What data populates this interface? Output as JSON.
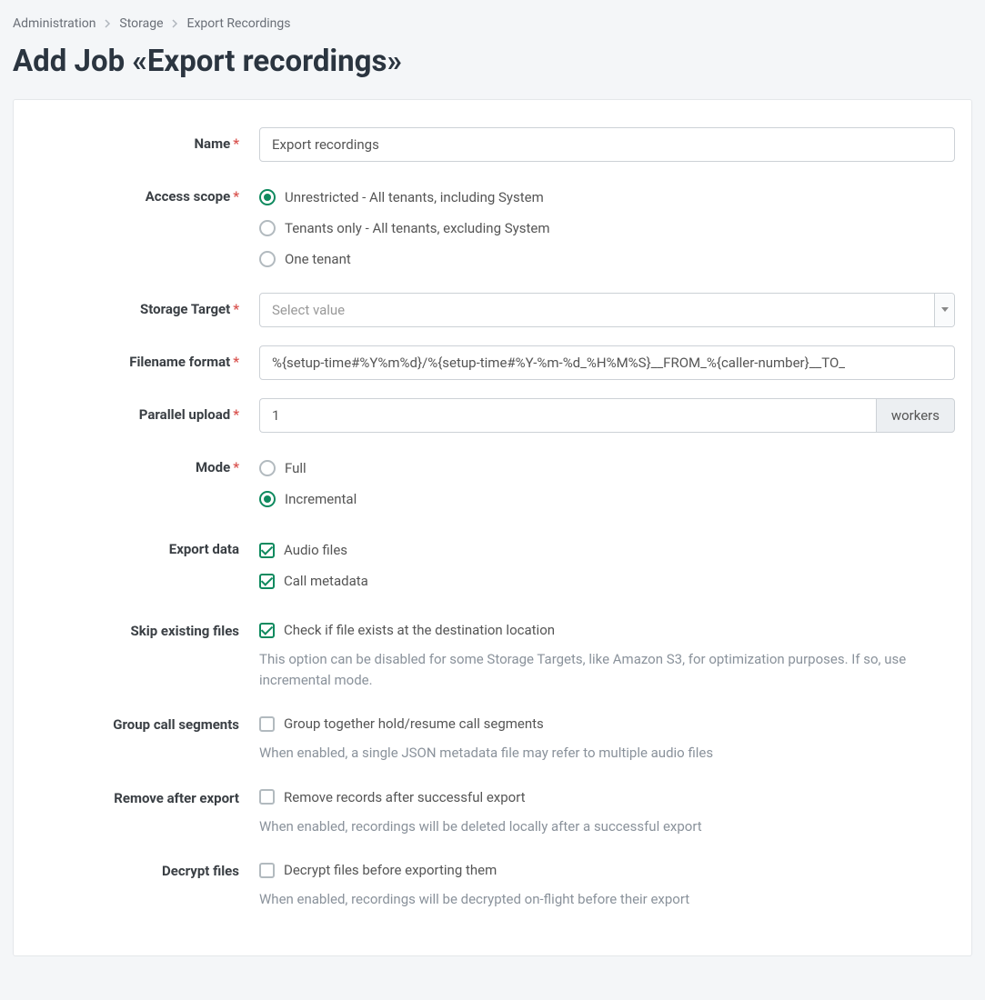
{
  "breadcrumb": {
    "items": [
      "Administration",
      "Storage",
      "Export Recordings"
    ]
  },
  "page_title": "Add Job «Export recordings»",
  "labels": {
    "name": "Name",
    "access_scope": "Access scope",
    "storage_target": "Storage Target",
    "filename_format": "Filename format",
    "parallel_upload": "Parallel upload",
    "mode": "Mode",
    "export_data": "Export data",
    "skip_existing": "Skip existing files",
    "group_segments": "Group call segments",
    "remove_after": "Remove after export",
    "decrypt_files": "Decrypt files"
  },
  "form": {
    "name_value": "Export recordings",
    "access_scope_options": {
      "unrestricted": "Unrestricted - All tenants, including System",
      "tenants_only": "Tenants only - All tenants, excluding System",
      "one_tenant": "One tenant"
    },
    "storage_target_placeholder": "Select value",
    "filename_format_value": "%{setup-time#%Y%m%d}/%{setup-time#%Y-%m-%d_%H%M%S}__FROM_%{caller-number}__TO_",
    "parallel_upload_value": "1",
    "parallel_upload_unit": "workers",
    "mode_options": {
      "full": "Full",
      "incremental": "Incremental"
    },
    "export_data_options": {
      "audio": "Audio files",
      "metadata": "Call metadata"
    },
    "skip_existing_label": "Check if file exists at the destination location",
    "skip_existing_help": "This option can be disabled for some Storage Targets, like Amazon S3, for optimization purposes. If so, use incremental mode.",
    "group_segments_label": "Group together hold/resume call segments",
    "group_segments_help": "When enabled, a single JSON metadata file may refer to multiple audio files",
    "remove_after_label": "Remove records after successful export",
    "remove_after_help": "When enabled, recordings will be deleted locally after a successful export",
    "decrypt_files_label": "Decrypt files before exporting them",
    "decrypt_files_help": "When enabled, recordings will be decrypted on-flight before their export"
  }
}
